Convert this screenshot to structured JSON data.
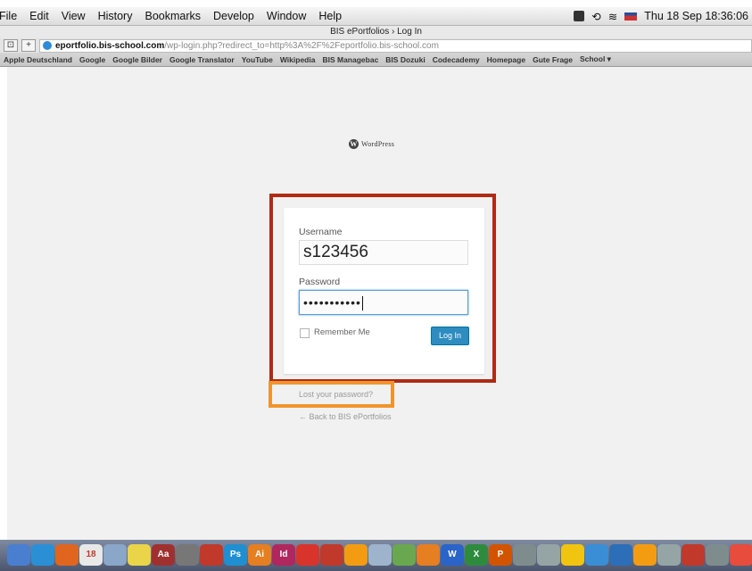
{
  "menubar": {
    "items": [
      "File",
      "Edit",
      "View",
      "History",
      "Bookmarks",
      "Develop",
      "Window",
      "Help"
    ],
    "clock": "Thu 18 Sep  18:36:06"
  },
  "browser": {
    "title": "BIS ePortfolios › Log In",
    "url_host": "eportfolio.bis-school.com",
    "url_path": "/wp-login.php?redirect_to=http%3A%2F%2Feportfolio.bis-school.com",
    "bookmarks": [
      "Apple Deutschland",
      "Google",
      "Google Bilder",
      "Google Translator",
      "YouTube",
      "Wikipedia",
      "BIS Managebac",
      "BIS Dozuki",
      "Codecademy",
      "Homepage",
      "Gute Frage",
      "School ▾"
    ]
  },
  "login": {
    "logo_text": "WordPress",
    "username_label": "Username",
    "username_value": "s123456",
    "password_label": "Password",
    "password_value": "•••••••••••",
    "remember_label": "Remember Me",
    "login_button": "Log In",
    "lost_password": "Lost your password?",
    "back_link": "← Back to BIS ePortfolios"
  },
  "dock": {
    "icons": [
      {
        "name": "finder-icon",
        "color": "#4a7fd0",
        "glyph": ""
      },
      {
        "name": "safari-icon",
        "color": "#2b8fd6",
        "glyph": ""
      },
      {
        "name": "firefox-icon",
        "color": "#e0661f",
        "glyph": ""
      },
      {
        "name": "calendar-icon",
        "color": "#e8e8e8",
        "glyph": "18"
      },
      {
        "name": "preview-icon",
        "color": "#8aa6c8",
        "glyph": ""
      },
      {
        "name": "stickies-icon",
        "color": "#e9d44a",
        "glyph": ""
      },
      {
        "name": "dictionary-icon",
        "color": "#a03030",
        "glyph": "Aa"
      },
      {
        "name": "calculator-icon",
        "color": "#777",
        "glyph": ""
      },
      {
        "name": "books-icon",
        "color": "#c0392b",
        "glyph": ""
      },
      {
        "name": "photoshop-icon",
        "color": "#1f8fd1",
        "glyph": "Ps"
      },
      {
        "name": "illustrator-icon",
        "color": "#e67e22",
        "glyph": "Ai"
      },
      {
        "name": "indesign-icon",
        "color": "#b0265f",
        "glyph": "Id"
      },
      {
        "name": "app-red-icon",
        "color": "#d9342b",
        "glyph": ""
      },
      {
        "name": "app-red2-icon",
        "color": "#c0392b",
        "glyph": ""
      },
      {
        "name": "app-orange-icon",
        "color": "#f39c12",
        "glyph": ""
      },
      {
        "name": "app-pen-icon",
        "color": "#9db4cc",
        "glyph": ""
      },
      {
        "name": "app-chart-icon",
        "color": "#6aa84f",
        "glyph": ""
      },
      {
        "name": "app-web-icon",
        "color": "#e67e22",
        "glyph": ""
      },
      {
        "name": "word-icon",
        "color": "#2b64c8",
        "glyph": "W"
      },
      {
        "name": "excel-icon",
        "color": "#2e8b3e",
        "glyph": "X"
      },
      {
        "name": "powerpoint-icon",
        "color": "#d35400",
        "glyph": "P"
      },
      {
        "name": "app-photo-icon",
        "color": "#7f8c8d",
        "glyph": ""
      },
      {
        "name": "app-star-icon",
        "color": "#95a5a6",
        "glyph": ""
      },
      {
        "name": "garageband-icon",
        "color": "#f1c40f",
        "glyph": ""
      },
      {
        "name": "itunes-icon",
        "color": "#3a8ed6",
        "glyph": ""
      },
      {
        "name": "app-search-icon",
        "color": "#2c6fb8",
        "glyph": ""
      },
      {
        "name": "vlc-icon",
        "color": "#f39c12",
        "glyph": ""
      },
      {
        "name": "app-photos-icon",
        "color": "#95a5a6",
        "glyph": ""
      },
      {
        "name": "acrobat-icon",
        "color": "#c0392b",
        "glyph": ""
      },
      {
        "name": "app-pencil-icon",
        "color": "#7f8c8d",
        "glyph": ""
      },
      {
        "name": "app-tool-icon",
        "color": "#e74c3c",
        "glyph": ""
      },
      {
        "name": "app-note-icon",
        "color": "#f1c40f",
        "glyph": ""
      }
    ]
  }
}
